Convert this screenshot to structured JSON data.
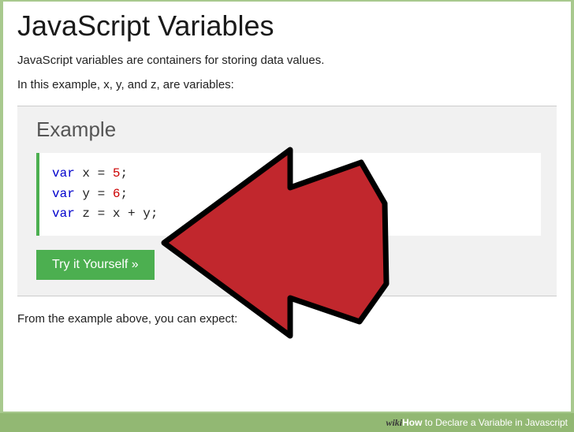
{
  "title": "JavaScript Variables",
  "intro1": "JavaScript variables are containers for storing data values.",
  "intro2": "In this example, x, y, and z, are variables:",
  "example": {
    "heading": "Example",
    "code": {
      "kw": "var",
      "line1_var": "x",
      "line1_val": "5",
      "line2_var": "y",
      "line2_val": "6",
      "line3_var": "z",
      "line3_expr": "x + y",
      "equals": " = ",
      "semicolon": ";"
    },
    "button": "Try it Yourself »"
  },
  "outro": "From the example above, you can expect:",
  "footer": {
    "brand_wiki": "wiki",
    "brand_how": "How",
    "tagline": " to Declare a Variable in Javascript"
  },
  "overlay": {
    "arrow": "large red cursor-arrow pointing left at the code block"
  }
}
